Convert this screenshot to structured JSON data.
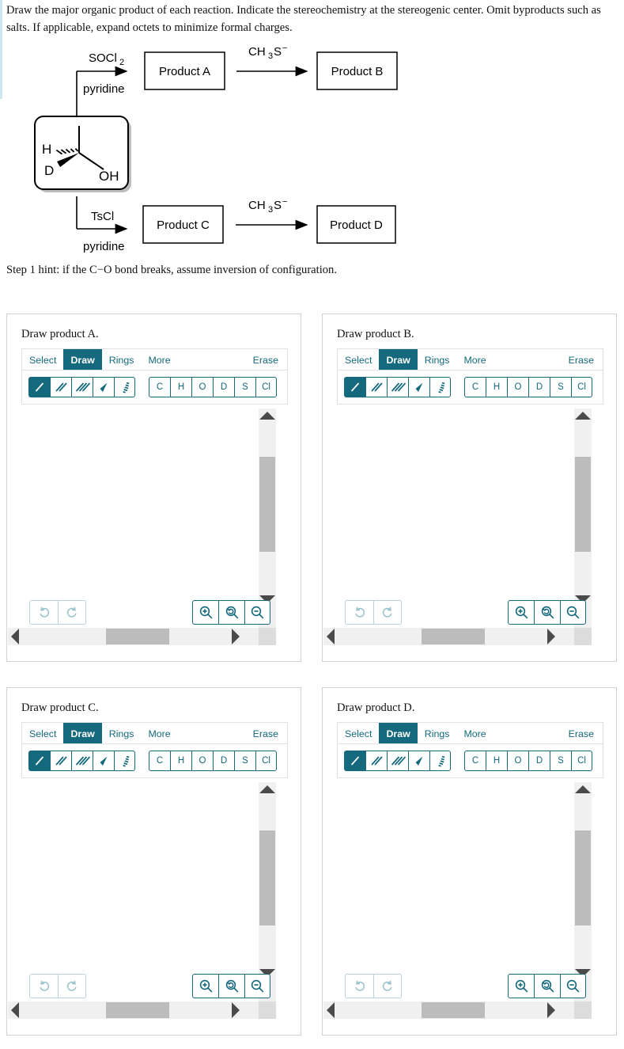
{
  "prompt": "Draw the major organic product of each reaction. Indicate the stereochemistry at the stereogenic center. Omit byproducts such as salts. If applicable, expand octets to minimize formal charges.",
  "hint": "Step 1 hint: if the C−O bond breaks, assume inversion of configuration.",
  "scheme": {
    "reagent_top_above": "SOCl",
    "reagent_top_above_sub": "2",
    "reagent_top_below": "pyridine",
    "reagent_bottom_above": "TsCl",
    "reagent_bottom_below": "pyridine",
    "reagent_second_step": "CH",
    "reagent_second_step_sub": "3",
    "reagent_second_step_tail": "S",
    "reagent_second_step_charge": "−",
    "product_a": "Product A",
    "product_b": "Product B",
    "product_c": "Product C",
    "product_d": "Product D",
    "molecule": {
      "label_h": "H",
      "label_d": "D",
      "label_oh": "OH"
    }
  },
  "panels": [
    {
      "id": "a",
      "title": "Draw product A.",
      "tabs": [
        {
          "label": "Select",
          "active": false
        },
        {
          "label": "Draw",
          "active": true
        },
        {
          "label": "Rings",
          "active": false
        },
        {
          "label": "More",
          "active": false
        }
      ],
      "erase_label": "Erase",
      "bond_tools": [
        {
          "name": "single-bond",
          "selected": true
        },
        {
          "name": "double-bond",
          "selected": false
        },
        {
          "name": "triple-bond",
          "selected": false
        },
        {
          "name": "wedge-bond",
          "selected": false
        },
        {
          "name": "hash-bond",
          "selected": false
        }
      ],
      "atoms": [
        "C",
        "H",
        "O",
        "D",
        "S",
        "Cl"
      ]
    },
    {
      "id": "b",
      "title": "Draw product B.",
      "tabs": [
        {
          "label": "Select",
          "active": false
        },
        {
          "label": "Draw",
          "active": true
        },
        {
          "label": "Rings",
          "active": false
        },
        {
          "label": "More",
          "active": false
        }
      ],
      "erase_label": "Erase",
      "bond_tools": [
        {
          "name": "single-bond",
          "selected": true
        },
        {
          "name": "double-bond",
          "selected": false
        },
        {
          "name": "triple-bond",
          "selected": false
        },
        {
          "name": "wedge-bond",
          "selected": false
        },
        {
          "name": "hash-bond",
          "selected": false
        }
      ],
      "atoms": [
        "C",
        "H",
        "O",
        "D",
        "S",
        "Cl"
      ]
    },
    {
      "id": "c",
      "title": "Draw product C.",
      "tabs": [
        {
          "label": "Select",
          "active": false
        },
        {
          "label": "Draw",
          "active": true
        },
        {
          "label": "Rings",
          "active": false
        },
        {
          "label": "More",
          "active": false
        }
      ],
      "erase_label": "Erase",
      "bond_tools": [
        {
          "name": "single-bond",
          "selected": true
        },
        {
          "name": "double-bond",
          "selected": false
        },
        {
          "name": "triple-bond",
          "selected": false
        },
        {
          "name": "wedge-bond",
          "selected": false
        },
        {
          "name": "hash-bond",
          "selected": false
        }
      ],
      "atoms": [
        "C",
        "H",
        "O",
        "D",
        "S",
        "Cl"
      ]
    },
    {
      "id": "d",
      "title": "Draw product D.",
      "tabs": [
        {
          "label": "Select",
          "active": false
        },
        {
          "label": "Draw",
          "active": true
        },
        {
          "label": "Rings",
          "active": false
        },
        {
          "label": "More",
          "active": false
        }
      ],
      "erase_label": "Erase",
      "bond_tools": [
        {
          "name": "single-bond",
          "selected": true
        },
        {
          "name": "double-bond",
          "selected": false
        },
        {
          "name": "triple-bond",
          "selected": false
        },
        {
          "name": "wedge-bond",
          "selected": false
        },
        {
          "name": "hash-bond",
          "selected": false
        }
      ],
      "atoms": [
        "C",
        "H",
        "O",
        "D",
        "S",
        "Cl"
      ]
    }
  ],
  "colors": {
    "accent_teal": "#14697d",
    "scroll_thumb": "#bcbcbc",
    "scroll_track": "#f0f0f0",
    "panel_border": "#d2d2d2"
  }
}
